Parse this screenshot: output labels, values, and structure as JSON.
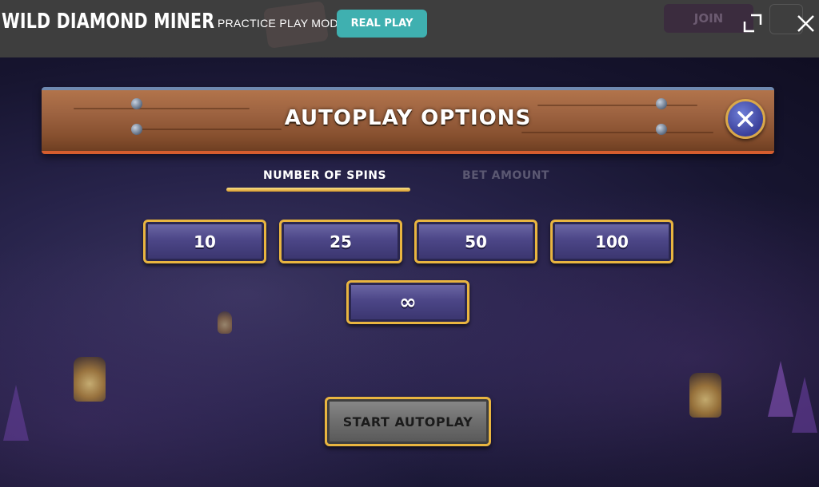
{
  "topbar": {
    "game_title": "WILD DIAMOND MINER",
    "mode_label": "PRACTICE PLAY MODE",
    "real_play_label": "REAL PLAY",
    "join_label": "JOIN",
    "fullscreen_icon": "fullscreen-icon",
    "close_icon": "close-icon",
    "accent_color": "#3fb0b0"
  },
  "dialog": {
    "title": "AUTOPLAY OPTIONS",
    "close_icon": "close-icon",
    "tabs": [
      {
        "label": "NUMBER OF SPINS",
        "active": true
      },
      {
        "label": "BET AMOUNT",
        "active": false
      }
    ],
    "spin_options": [
      "10",
      "25",
      "50",
      "100",
      "∞"
    ],
    "start_label": "START AUTOPLAY"
  }
}
